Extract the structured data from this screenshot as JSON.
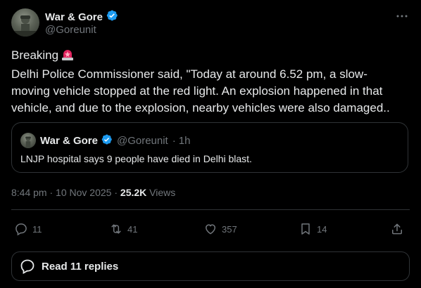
{
  "author": {
    "name": "War & Gore",
    "handle": "@Goreunit",
    "verified": true
  },
  "tweet": {
    "line1": "Breaking",
    "line1_icon": "police-light-emoji",
    "body": "Delhi Police Commissioner said, \"Today at around 6.52 pm, a slow-moving vehicle stopped at the red light. An explosion happened in that vehicle, and due to the explosion, nearby vehicles were also damaged.."
  },
  "quote": {
    "name": "War & Gore",
    "handle": "@Goreunit",
    "separator": "·",
    "time": "1h",
    "text": "LNJP hospital says 9 people have died in Delhi blast."
  },
  "meta": {
    "time": "8:44 pm",
    "dot1": "·",
    "date": "10 Nov 2025",
    "dot2": "·",
    "views_count": "25.2K",
    "views_label": "Views"
  },
  "actions": {
    "replies": "11",
    "reposts": "41",
    "likes": "357",
    "bookmarks": "14"
  },
  "read_replies": "Read 11 replies",
  "colors": {
    "background": "#000000",
    "text": "#e7e9ea",
    "muted": "#71767b",
    "border": "#2f3336",
    "verified": "#1d9bf0",
    "siren": "#e0245e"
  }
}
